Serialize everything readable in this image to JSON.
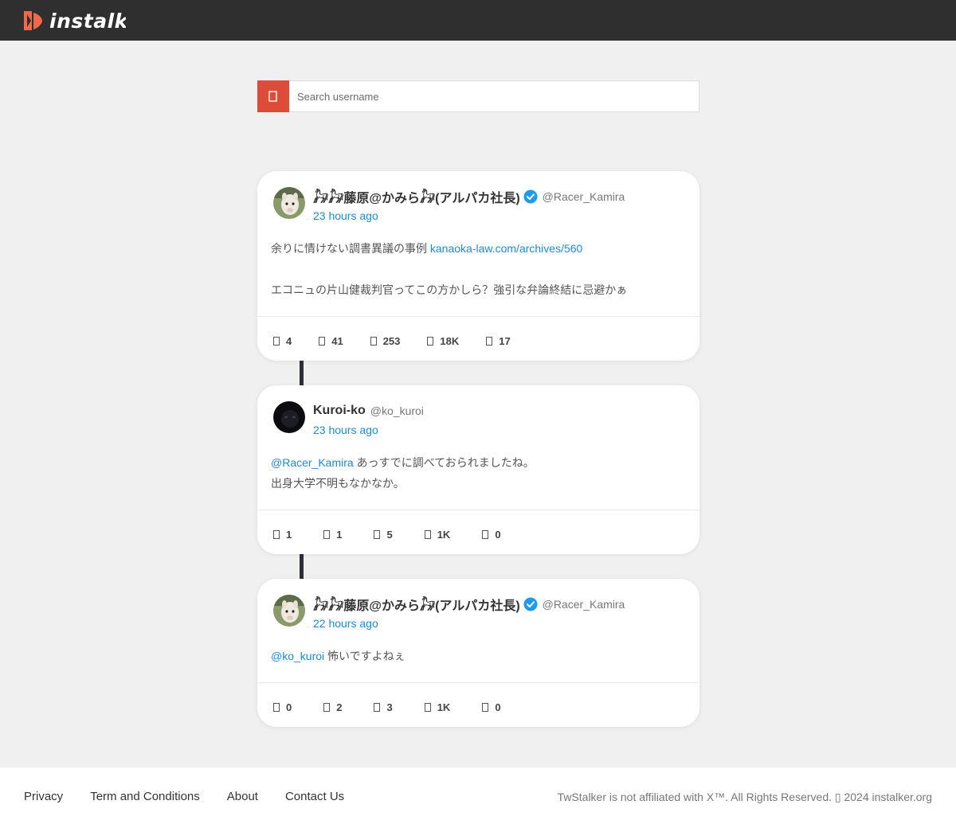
{
  "header": {
    "logo_text": "instalk",
    "brand_color": "#ef6a4c"
  },
  "search": {
    "placeholder": "Search username",
    "button_icon": "search-icon",
    "button_color": "#dd4b39"
  },
  "tweets": [
    {
      "display_name": "𓃗𓃗藤原@かみら𓃗(アルパカ社長)",
      "verified": true,
      "handle": "@Racer_Kamira",
      "time": "23 hours ago",
      "text_1": "余りに情けない調書異議の事例 ",
      "link": "kanaoka-law.com/archives/560",
      "text_2": "エコニュの片山健裁判官ってこの方かしら？強引な弁論終結に忌避かぁ",
      "stats": {
        "replies": "4",
        "retweets": "41",
        "likes": "253",
        "views": "18K",
        "bookmarks": "17"
      }
    },
    {
      "display_name": "Kuroi-ko",
      "verified": false,
      "handle": "@ko_kuroi",
      "time": "23 hours ago",
      "mention": "@Racer_Kamira",
      "text_1": " あっすでに調べておられましたね。",
      "text_2": "出身大学不明もなかなか。",
      "stats": {
        "replies": "1",
        "retweets": "1",
        "likes": "5",
        "views": "1K",
        "bookmarks": "0"
      }
    },
    {
      "display_name": "𓃗𓃗藤原@かみら𓃗(アルパカ社長)",
      "verified": true,
      "handle": "@Racer_Kamira",
      "time": "22 hours ago",
      "mention": "@ko_kuroi",
      "text_1": " 怖いですよねぇ",
      "stats": {
        "replies": "0",
        "retweets": "2",
        "likes": "3",
        "views": "1K",
        "bookmarks": "0"
      }
    }
  ],
  "footer": {
    "links": [
      "Privacy",
      "Term and Conditions",
      "About",
      "Contact Us"
    ],
    "copyright": "TwStalker is not affiliated with X™. All Rights Reserved. ▯ 2024 instalker.org"
  },
  "colors": {
    "link": "#1d8ad8",
    "verified_badge": "#1d9bf0",
    "connector": "#2b3036"
  }
}
